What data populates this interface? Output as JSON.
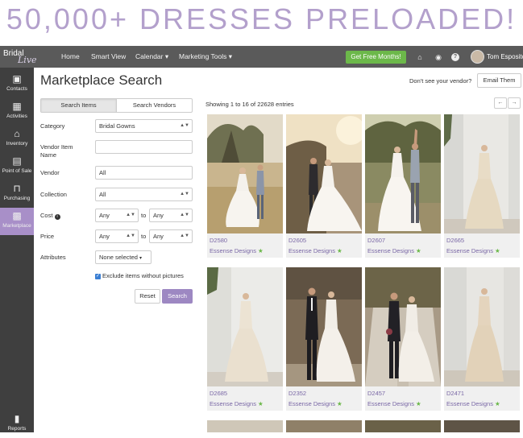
{
  "banner": "50,000+ DRESSES PRELOADED!",
  "topbar": {
    "logo_main": "Bridal",
    "logo_sub": "Live",
    "nav": [
      "Home",
      "Smart View",
      "Calendar ▾",
      "Marketing Tools ▾"
    ],
    "cta": "Get Free Months!",
    "user": "Tom Esposito"
  },
  "sidebar": [
    {
      "label": "Contacts",
      "icon": "contacts-icon",
      "glyph": "▣"
    },
    {
      "label": "Activities",
      "icon": "calendar-icon",
      "glyph": "▦"
    },
    {
      "label": "Inventory",
      "icon": "hanger-icon",
      "glyph": "⌂"
    },
    {
      "label": "Point of Sale",
      "icon": "register-icon",
      "glyph": "▤"
    },
    {
      "label": "Purchasing",
      "icon": "basket-icon",
      "glyph": "⊓"
    },
    {
      "label": "Marketplace",
      "icon": "shop-icon",
      "glyph": "▩"
    },
    {
      "label": "Reports",
      "icon": "chart-icon",
      "glyph": "▮"
    }
  ],
  "page": {
    "title": "Marketplace Search",
    "vendor_question": "Don't see your vendor?",
    "email_button": "Email Them"
  },
  "filters": {
    "tab_items": "Search Items",
    "tab_vendors": "Search Vendors",
    "category_label": "Category",
    "category_value": "Bridal Gowns",
    "vendor_item_label_1": "Vendor Item",
    "vendor_item_label_2": "Name",
    "vendor_item_value": "",
    "vendor_label": "Vendor",
    "vendor_value": "All",
    "collection_label": "Collection",
    "collection_value": "All",
    "cost_label": "Cost",
    "cost_from": "Any",
    "cost_to": "Any",
    "price_label": "Price",
    "price_from": "Any",
    "price_to": "Any",
    "to_text": "to",
    "attributes_label": "Attributes",
    "attributes_value": "None selected",
    "exclude_label": "Exclude items without pictures",
    "reset": "Reset",
    "search": "Search"
  },
  "results": {
    "summary": "Showing 1 to 16 of 22628 entries",
    "prev": "←",
    "next": "→",
    "items": [
      {
        "code": "D2580",
        "vendor": "Essense Designs"
      },
      {
        "code": "D2605",
        "vendor": "Essense Designs"
      },
      {
        "code": "D2607",
        "vendor": "Essense Designs"
      },
      {
        "code": "D2665",
        "vendor": "Essense Designs"
      },
      {
        "code": "D2685",
        "vendor": "Essense Designs"
      },
      {
        "code": "D2352",
        "vendor": "Essense Designs"
      },
      {
        "code": "D2457",
        "vendor": "Essense Designs"
      },
      {
        "code": "D2471",
        "vendor": "Essense Designs"
      }
    ],
    "star": "★"
  }
}
